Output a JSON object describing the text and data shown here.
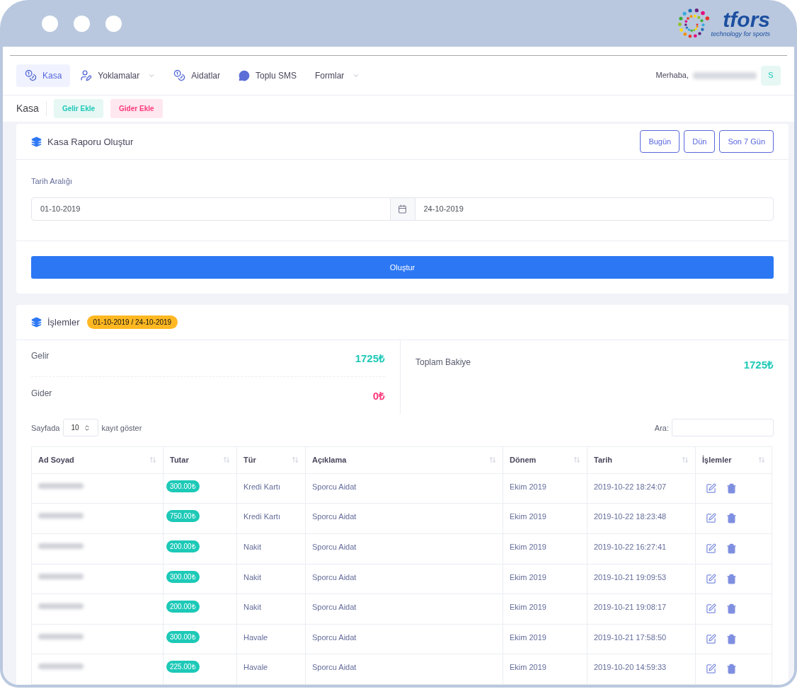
{
  "logo": {
    "name": "tfors",
    "tagline": "technology for sports"
  },
  "nav": [
    {
      "label": "Kasa",
      "kind": "cash",
      "selected": true,
      "dropdown": false
    },
    {
      "label": "Yoklamalar",
      "kind": "attendance",
      "selected": false,
      "dropdown": true
    },
    {
      "label": "Aidatlar",
      "kind": "fees",
      "selected": false,
      "dropdown": false
    },
    {
      "label": "Toplu SMS",
      "kind": "sms",
      "selected": false,
      "dropdown": false
    },
    {
      "label": "Formlar",
      "kind": "forms",
      "selected": false,
      "dropdown": true
    }
  ],
  "user": {
    "greeting": "Merhaba,",
    "avatar": "S"
  },
  "subheader": {
    "title": "Kasa",
    "buttons": [
      {
        "label": "Gelir Ekle",
        "kind": "income"
      },
      {
        "label": "Gider Ekle",
        "kind": "expense"
      }
    ]
  },
  "report": {
    "title": "Kasa Raporu Oluştur",
    "quick": [
      "Bugün",
      "Dün",
      "Son 7 Gün"
    ],
    "range_label": "Tarih Aralığı",
    "start": "01-10-2019",
    "end": "24-10-2019",
    "submit": "Oluştur"
  },
  "transactions": {
    "title": "İşlemler",
    "range": "01-10-2019 / 24-10-2019",
    "summary": [
      {
        "label": "Gelir",
        "value": "1725₺",
        "kind": "positive"
      },
      {
        "label": "Gider",
        "value": "0₺",
        "kind": "negative"
      }
    ],
    "balance": {
      "label": "Toplam Bakiye",
      "value": "1725₺"
    },
    "page_size_label": "Sayfada",
    "page_size": "10",
    "page_size_suffix": "kayıt göster",
    "search_label": "Ara:",
    "columns": [
      "Ad Soyad",
      "Tutar",
      "Tür",
      "Açıklama",
      "Dönem",
      "Tarih",
      "İşlemler"
    ],
    "rows": [
      {
        "amount": "300.00₺",
        "type": "Kredi Kartı",
        "desc": "Sporcu Aidat",
        "period": "Ekim 2019",
        "date": "2019-10-22 18:24:07"
      },
      {
        "amount": "750.00₺",
        "type": "Kredi Kartı",
        "desc": "Sporcu Aidat",
        "period": "Ekim 2019",
        "date": "2019-10-22 18:23:48"
      },
      {
        "amount": "200.00₺",
        "type": "Nakit",
        "desc": "Sporcu Aidat",
        "period": "Ekim 2019",
        "date": "2019-10-22 16:27:41"
      },
      {
        "amount": "300.00₺",
        "type": "Nakit",
        "desc": "Sporcu Aidat",
        "period": "Ekim 2019",
        "date": "2019-10-21 19:09:53"
      },
      {
        "amount": "200.00₺",
        "type": "Nakit",
        "desc": "Sporcu Aidat",
        "period": "Ekim 2019",
        "date": "2019-10-21 19:08:17"
      },
      {
        "amount": "300.00₺",
        "type": "Havale",
        "desc": "Sporcu Aidat",
        "period": "Ekim 2019",
        "date": "2019-10-21 17:58:50"
      },
      {
        "amount": "225.00₺",
        "type": "Havale",
        "desc": "Sporcu Aidat",
        "period": "Ekim 2019",
        "date": "2019-10-20 14:59:33"
      }
    ]
  }
}
